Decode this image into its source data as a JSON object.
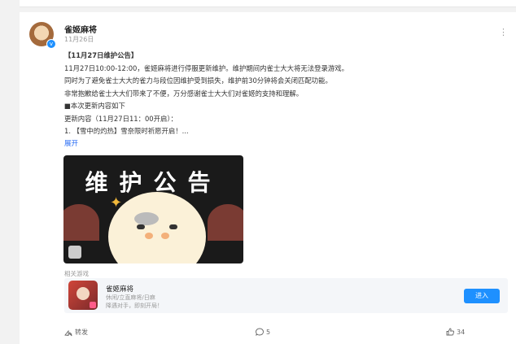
{
  "post": {
    "author": "雀姬麻将",
    "date": "11月26日",
    "title": "【11月27日维护公告】",
    "lines": [
      "11月27日10:00-12:00，雀姬麻将进行停服更新维护。维护期间内雀士大大将无法登录游戏。",
      "同时为了避免雀士大大的雀力与段位因维护受到损失，维护前30分钟将会关闭匹配功能。",
      "非常抱歉给雀士大大们带来了不便，万分感谢雀士大大们对雀姬的支持和理解。",
      "■本次更新内容如下",
      "更新内容（11月27日11：00开启）：",
      "1. 【雪中的灼热】雪奈限时祈愿开启！..."
    ],
    "expand_label": "展开",
    "banner_title": "维护公告"
  },
  "related": {
    "label": "相关游戏",
    "game_name": "雀姬麻将",
    "genre": "休闲/立直麻将/日麻",
    "desc": "降遇对手，即刻开局！",
    "enter_label": "进入"
  },
  "actions": {
    "share_label": "转发",
    "comment_count": "5",
    "like_count": "34"
  }
}
